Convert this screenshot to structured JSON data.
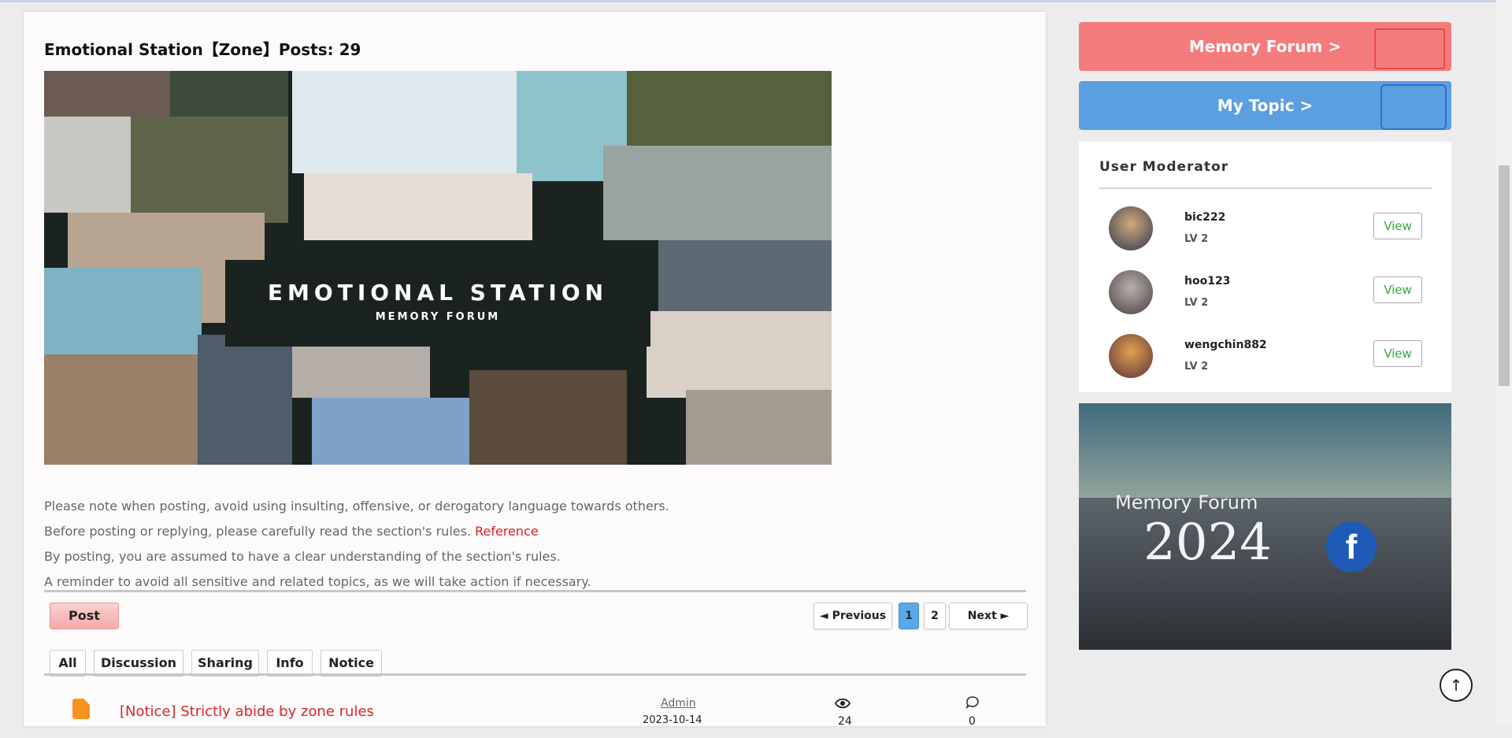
{
  "zone": {
    "title": "Emotional Station【Zone】Posts: 29"
  },
  "banner": {
    "title": "EMOTIONAL STATION",
    "subtitle": "MEMORY FORUM"
  },
  "notes": {
    "line1": "Please note when posting, avoid using insulting, offensive, or derogatory language towards others.",
    "line2": "Before posting or replying, please carefully read the section's rules.",
    "reference": "Reference",
    "line3": "By posting, you are assumed to have a clear understanding of the section's rules.",
    "line4": "A reminder to avoid all sensitive and related topics, as we will take action if necessary."
  },
  "toolbar": {
    "post_label": "Post"
  },
  "pager": {
    "previous": "◄ Previous",
    "pages": [
      "1",
      "2"
    ],
    "current": "1",
    "next": "Next ►"
  },
  "filters": [
    "All",
    "Discussion",
    "Sharing",
    "Info",
    "Notice"
  ],
  "posts": [
    {
      "icon": "document-icon",
      "title": "[Notice] Strictly abide by zone rules",
      "author": "Admin",
      "date": "2023-10-14",
      "views": "24",
      "replies": "0"
    }
  ],
  "sidebar": {
    "memory_forum": "Memory Forum >",
    "my_topic": "My Topic >",
    "moderator_title": "User Moderator",
    "moderators": [
      {
        "name": "bic222",
        "level": "LV 2",
        "action": "View"
      },
      {
        "name": "hoo123",
        "level": "LV 2",
        "action": "View"
      },
      {
        "name": "wengchin882",
        "level": "LV 2",
        "action": "View"
      }
    ],
    "ad": {
      "title": "Memory Forum",
      "year": "2024",
      "social": "f"
    }
  },
  "icons": {
    "views": "eye-icon",
    "replies": "speech-bubble-icon",
    "scroll_top": "arrow-up-icon"
  },
  "colors": {
    "notice_red": "#d62828",
    "memory_button": "#f47b7b",
    "topic_button": "#5b9fe0",
    "view_green": "#3aa14a",
    "pager_active": "#5aa9e6"
  }
}
